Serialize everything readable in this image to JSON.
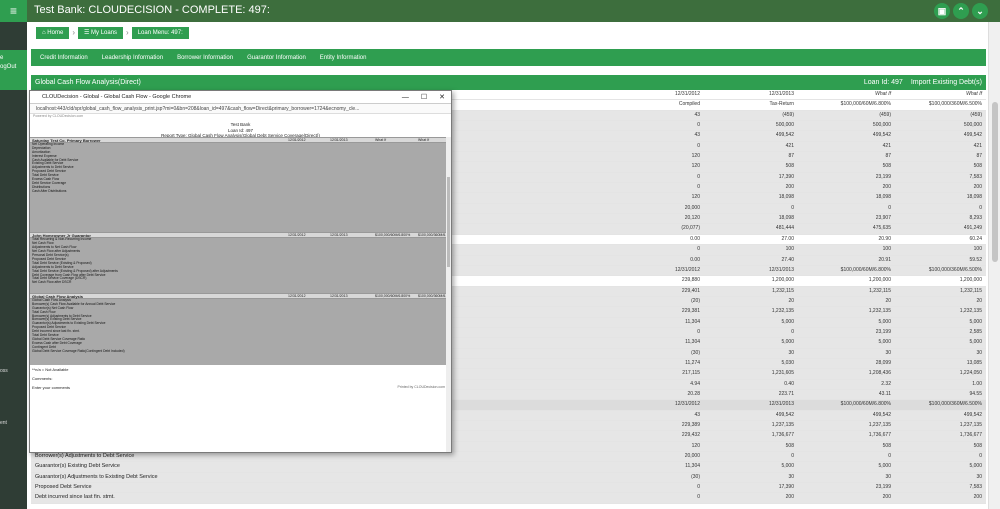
{
  "header": {
    "menu_icon": "hamburger-icon",
    "title": "Test Bank: CLOUDECISION - COMPLETE: 497:",
    "icons": [
      "save-icon",
      "chevron-up-icon",
      "chevron-down-icon"
    ]
  },
  "sidebar": {
    "tab_lines": [
      "e",
      "ogOut"
    ],
    "labels": [
      "oss",
      "ent"
    ]
  },
  "breadcrumb": [
    "Home",
    "My Loans",
    "Loan Menu: 497:"
  ],
  "tabs": [
    "Credit Information",
    "Leadership Information",
    "Borrower Information",
    "Guarantor Information",
    "Entity Information"
  ],
  "section": {
    "title": "Global Cash Flow Analysis(Direct)",
    "loan_id": "Loan Id: 497",
    "import_label": "Import Existing Debt(s)"
  },
  "table": {
    "rows": [
      {
        "label": "",
        "v": [
          "12/31/2012",
          "12/31/2013",
          "What If",
          "What If"
        ],
        "style": "white"
      },
      {
        "label": "",
        "v": [
          "Compiled",
          "Tax-Return",
          "$100,000/60M/6.800%",
          "$100,000/360M/6.500%"
        ],
        "style": "white"
      },
      {
        "label": "",
        "v": [
          "43",
          "(459)",
          "(459)",
          "(459)"
        ]
      },
      {
        "label": "",
        "v": [
          "0",
          "500,000",
          "500,000",
          "500,000"
        ]
      },
      {
        "label": "",
        "v": [
          "43",
          "499,542",
          "499,542",
          "499,542"
        ]
      },
      {
        "label": "",
        "v": [
          "0",
          "421",
          "421",
          "421"
        ]
      },
      {
        "label": "",
        "v": [
          "120",
          "87",
          "87",
          "87"
        ]
      },
      {
        "label": "",
        "v": [
          "120",
          "508",
          "508",
          "508"
        ]
      },
      {
        "label": "",
        "v": [
          "0",
          "17,390",
          "23,199",
          "7,583"
        ]
      },
      {
        "label": "",
        "v": [
          "0",
          "200",
          "200",
          "200"
        ]
      },
      {
        "label": "",
        "v": [
          "120",
          "18,098",
          "18,098",
          "18,098"
        ]
      },
      {
        "label": "",
        "v": [
          "20,000",
          "0",
          "0",
          "0"
        ]
      },
      {
        "label": "",
        "v": [
          "20,120",
          "18,098",
          "23,907",
          "8,293"
        ]
      },
      {
        "label": "",
        "v": [
          "(20,077)",
          "481,444",
          "475,635",
          "491,249"
        ]
      },
      {
        "label": "",
        "v": [
          "0.00",
          "27.00",
          "20.90",
          "60.24"
        ],
        "style": "white"
      },
      {
        "label": "",
        "v": [
          "0",
          "100",
          "100",
          "100"
        ]
      },
      {
        "label": "",
        "v": [
          "0.00",
          "27.40",
          "20.91",
          "59.52"
        ]
      },
      {
        "label": "",
        "v": [
          "12/31/2012",
          "12/31/2013",
          "$100,000/60M/6.800%",
          "$100,000/360M/6.500%"
        ]
      },
      {
        "label": "",
        "v": [
          "239,880",
          "1,200,000",
          "1,200,000",
          "1,200,000"
        ],
        "style": "white"
      },
      {
        "label": "",
        "v": [
          "229,401",
          "1,232,115",
          "1,232,115",
          "1,232,115"
        ]
      },
      {
        "label": "",
        "v": [
          "(20)",
          "20",
          "20",
          "20"
        ]
      },
      {
        "label": "",
        "v": [
          "229,381",
          "1,232,135",
          "1,232,135",
          "1,232,135"
        ]
      },
      {
        "label": "",
        "v": [
          "11,304",
          "5,000",
          "5,000",
          "5,000"
        ]
      },
      {
        "label": "",
        "v": [
          "0",
          "0",
          "23,199",
          "2,585"
        ]
      },
      {
        "label": "",
        "v": [
          "11,304",
          "5,000",
          "5,000",
          "5,000"
        ]
      },
      {
        "label": "",
        "v": [
          "(30)",
          "30",
          "30",
          "30"
        ]
      },
      {
        "label": "",
        "v": [
          "11,274",
          "5,030",
          "28,099",
          "13,085"
        ]
      },
      {
        "label": "",
        "v": [
          "217,115",
          "1,231,605",
          "1,208,436",
          "1,224,050"
        ]
      },
      {
        "label": "",
        "v": [
          "4.94",
          "0.40",
          "2.32",
          "1.00"
        ]
      },
      {
        "label": "",
        "v": [
          "20.28",
          "223.71",
          "43.11",
          "94.55"
        ]
      },
      {
        "label": "",
        "v": [
          "12/31/2012",
          "12/31/2013",
          "$100,000/60M/6.800%",
          "$100,000/360M/6.500%"
        ],
        "style": "hdr"
      },
      {
        "label": "",
        "v": [
          "43",
          "499,542",
          "499,542",
          "499,542"
        ]
      },
      {
        "label": "",
        "v": [
          "229,389",
          "1,237,135",
          "1,237,135",
          "1,237,135"
        ]
      },
      {
        "label": "",
        "v": [
          "229,432",
          "1,736,677",
          "1,736,677",
          "1,736,677"
        ]
      },
      {
        "label": "Borrower(s) Existing Debt Service",
        "v": [
          "120",
          "508",
          "508",
          "508"
        ]
      },
      {
        "label": "Borrower(s) Adjustments to Debt Service",
        "v": [
          "20,000",
          "0",
          "0",
          "0"
        ]
      },
      {
        "label": "Guarantor(s) Existing Debt Service",
        "v": [
          "11,304",
          "5,000",
          "5,000",
          "5,000"
        ]
      },
      {
        "label": "Guarantor(s) Adjustments to Existing Debt Service",
        "v": [
          "(30)",
          "30",
          "30",
          "30"
        ]
      },
      {
        "label": "Proposed Debt Service",
        "v": [
          "0",
          "17,390",
          "23,199",
          "7,583"
        ]
      },
      {
        "label": "Debt incurred since last fin. stmt.",
        "v": [
          "0",
          "200",
          "200",
          "200"
        ]
      }
    ]
  },
  "popup": {
    "window_title": "CLOUDecision - Global - Global Cash Flow - Google Chrome",
    "controls": [
      "—",
      "☐",
      "✕"
    ],
    "url": "localhost:443/cld/spr/global_cash_flow_analysis_print.jsp?mi=0&bn=208&loan_id=497&cash_flow=Direct&primary_borrower=1724&ecnomy_cle...",
    "powered": "Powered by CLOUDecision.com",
    "report_lines": [
      "Test Bank",
      "Loan Id: 497",
      "Report Type: Global Cash Flow Analysis(Global Debt Service Coverage(Direct))"
    ],
    "sections": [
      {
        "title": "Saturday Test Co.  Primary Borrower",
        "cols": [
          "12/31/2012",
          "12/31/2013",
          "What If",
          "What If"
        ],
        "lines": 23
      },
      {
        "title": "John Homeowner Jr   Guarantor",
        "cols": [
          "12/31/2012",
          "12/31/2013",
          "$100,000/60M/6.800%",
          "$100,000/360M/6.500%"
        ],
        "lines": 14
      },
      {
        "title": "Global Cash Flow Analysis",
        "cols": [
          "12/31/2012",
          "12/31/2013",
          "$100,000/60M/6.800%",
          "$100,000/360M/6.500%"
        ],
        "lines": 17
      }
    ],
    "borrower_labels": [
      "Net Operating Income",
      "Depreciation",
      "Amortization",
      "Interest Expense",
      "Cash Available for Debt Service",
      "Existing Debt Service",
      "Adjustments to Debt Service",
      "Proposed Debt Service",
      "Total Debt Service",
      "Excess Cash Flow",
      "Debt Service Coverage",
      "Distributions",
      "Cash After Distributions"
    ],
    "guarantor_labels": [
      "Total Recurring & Non-Recurring Income",
      "Net Cash Flow",
      "Adjustments to Net Cash Flow",
      "Net Cash Flow after Adjustments",
      "Personal Debt Service(s)",
      "Proposed Debt Service",
      "Total Debt Service (Existing & Proposed)",
      "Adjustments to Debt Service",
      "Total Debt Service (Existing & Proposed) after Adjustments",
      "Debt Coverage from Cash Flow after Debt Service",
      "Total Debt Service Coverage (DSCR)",
      "Net Cash Flow after DSCR"
    ],
    "global_labels": [
      "Global Cash Flow Analysis",
      "Borrower(s) Cash Flow Available for Annual Debt Service",
      "Guarantor(s) Net Cash Flow",
      "Total Cash Flow",
      "Borrower(s) Adjustments to Debt Service",
      "Borrower(s) Existing Debt Service",
      "Guarantor(s) Adjustments to Existing Debt Service",
      "Proposed Debt Service",
      "Debt incurred since last fin. stmt.",
      "Total Debt Service",
      "Global Debt Service Coverage Ratio",
      "Excess Cash after Debt Coverage",
      "Contingent Debt",
      "Global Debt Service Coverage Ratio(Contingent Debt Included)"
    ],
    "footer": [
      "**n/a = Not Available",
      "Comments:",
      "Enter your comments"
    ],
    "footer_right": "Printed by CLOUDecision.com"
  },
  "colors": {
    "green": "#2f9e50",
    "dark_green": "#3d6e3d",
    "sidebar": "#2f3d35"
  }
}
